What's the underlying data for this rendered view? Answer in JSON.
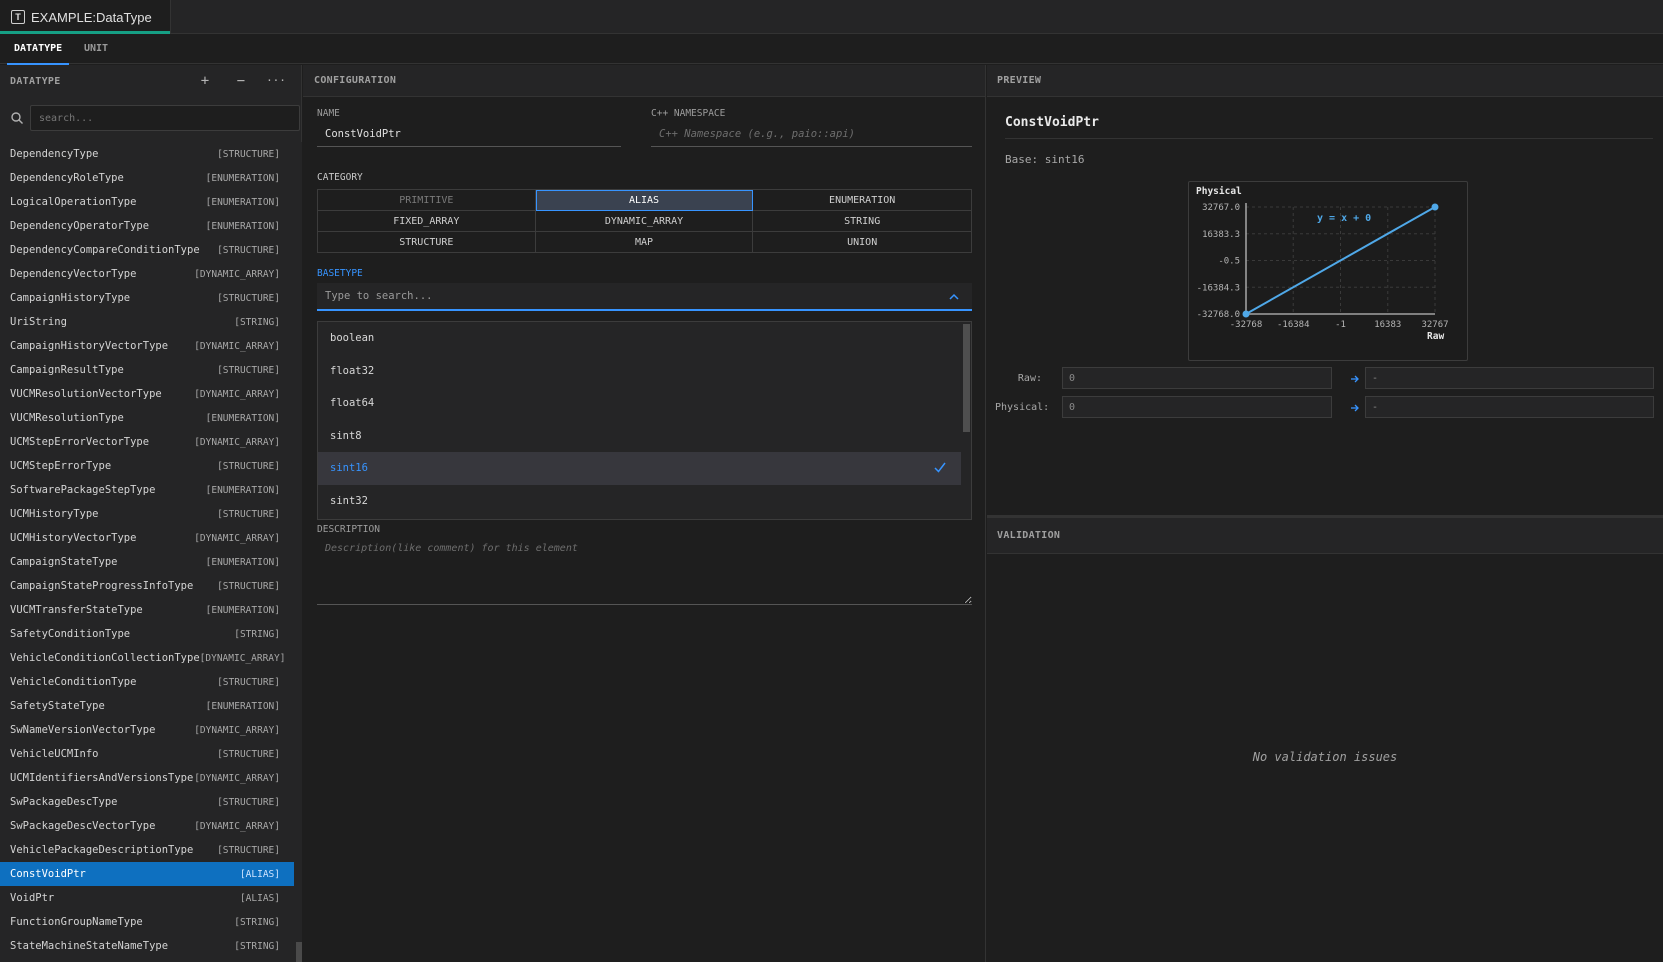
{
  "window": {
    "tab_title": "EXAMPLE:DataType",
    "tab_icon": "T"
  },
  "subtabs": [
    {
      "label": "DATATYPE",
      "active": true
    },
    {
      "label": "UNIT",
      "active": false
    }
  ],
  "left_panel": {
    "title": "DATATYPE",
    "add_label": "+",
    "remove_label": "−",
    "more_label": "···",
    "search_placeholder": "search...",
    "items": [
      {
        "name": "DependencyType",
        "kind": "[STRUCTURE]"
      },
      {
        "name": "DependencyRoleType",
        "kind": "[ENUMERATION]"
      },
      {
        "name": "LogicalOperationType",
        "kind": "[ENUMERATION]"
      },
      {
        "name": "DependencyOperatorType",
        "kind": "[ENUMERATION]"
      },
      {
        "name": "DependencyCompareConditionType",
        "kind": "[STRUCTURE]"
      },
      {
        "name": "DependencyVectorType",
        "kind": "[DYNAMIC_ARRAY]"
      },
      {
        "name": "CampaignHistoryType",
        "kind": "[STRUCTURE]"
      },
      {
        "name": "UriString",
        "kind": "[STRING]"
      },
      {
        "name": "CampaignHistoryVectorType",
        "kind": "[DYNAMIC_ARRAY]"
      },
      {
        "name": "CampaignResultType",
        "kind": "[STRUCTURE]"
      },
      {
        "name": "VUCMResolutionVectorType",
        "kind": "[DYNAMIC_ARRAY]"
      },
      {
        "name": "VUCMResolutionType",
        "kind": "[ENUMERATION]"
      },
      {
        "name": "UCMStepErrorVectorType",
        "kind": "[DYNAMIC_ARRAY]"
      },
      {
        "name": "UCMStepErrorType",
        "kind": "[STRUCTURE]"
      },
      {
        "name": "SoftwarePackageStepType",
        "kind": "[ENUMERATION]"
      },
      {
        "name": "UCMHistoryType",
        "kind": "[STRUCTURE]"
      },
      {
        "name": "UCMHistoryVectorType",
        "kind": "[DYNAMIC_ARRAY]"
      },
      {
        "name": "CampaignStateType",
        "kind": "[ENUMERATION]"
      },
      {
        "name": "CampaignStateProgressInfoType",
        "kind": "[STRUCTURE]"
      },
      {
        "name": "VUCMTransferStateType",
        "kind": "[ENUMERATION]"
      },
      {
        "name": "SafetyConditionType",
        "kind": "[STRING]"
      },
      {
        "name": "VehicleConditionCollectionType",
        "kind": "[DYNAMIC_ARRAY]"
      },
      {
        "name": "VehicleConditionType",
        "kind": "[STRUCTURE]"
      },
      {
        "name": "SafetyStateType",
        "kind": "[ENUMERATION]"
      },
      {
        "name": "SwNameVersionVectorType",
        "kind": "[DYNAMIC_ARRAY]"
      },
      {
        "name": "VehicleUCMInfo",
        "kind": "[STRUCTURE]"
      },
      {
        "name": "UCMIdentifiersAndVersionsType",
        "kind": "[DYNAMIC_ARRAY]"
      },
      {
        "name": "SwPackageDescType",
        "kind": "[STRUCTURE]"
      },
      {
        "name": "SwPackageDescVectorType",
        "kind": "[DYNAMIC_ARRAY]"
      },
      {
        "name": "VehiclePackageDescriptionType",
        "kind": "[STRUCTURE]"
      },
      {
        "name": "ConstVoidPtr",
        "kind": "[ALIAS]",
        "selected": true
      },
      {
        "name": "VoidPtr",
        "kind": "[ALIAS]"
      },
      {
        "name": "FunctionGroupNameType",
        "kind": "[STRING]"
      },
      {
        "name": "StateMachineStateNameType",
        "kind": "[STRING]"
      }
    ]
  },
  "config": {
    "title": "CONFIGURATION",
    "name_label": "NAME",
    "name_value": "ConstVoidPtr",
    "namespace_label": "C++ NAMESPACE",
    "namespace_placeholder": "C++ Namespace (e.g., paio::api)",
    "category_label": "CATEGORY",
    "categories": [
      {
        "label": "PRIMITIVE",
        "state": "disabled"
      },
      {
        "label": "ALIAS",
        "state": "active"
      },
      {
        "label": "ENUMERATION",
        "state": "normal"
      },
      {
        "label": "FIXED_ARRAY",
        "state": "normal"
      },
      {
        "label": "DYNAMIC_ARRAY",
        "state": "normal"
      },
      {
        "label": "STRING",
        "state": "normal"
      },
      {
        "label": "STRUCTURE",
        "state": "normal"
      },
      {
        "label": "MAP",
        "state": "normal"
      },
      {
        "label": "UNION",
        "state": "normal"
      }
    ],
    "basetype_label": "BASETYPE",
    "basetype_placeholder": "Type to search...",
    "basetype_options": [
      {
        "label": "boolean"
      },
      {
        "label": "float32"
      },
      {
        "label": "float64"
      },
      {
        "label": "sint8"
      },
      {
        "label": "sint16",
        "selected": true
      },
      {
        "label": "sint32"
      }
    ],
    "description_label": "DESCRIPTION",
    "description_placeholder": "Description(like comment) for this element"
  },
  "preview": {
    "title": "PREVIEW",
    "name": "ConstVoidPtr",
    "base": "Base: sint16",
    "raw_label": "Raw:",
    "raw_value": "0",
    "raw_result": "-",
    "physical_label": "Physical:",
    "physical_value": "0",
    "physical_result": "-"
  },
  "chart_data": {
    "type": "line",
    "ylabel": "Physical",
    "xlabel": "Raw",
    "formula": "y = x + 0",
    "x_ticks": [
      "-32768",
      "-16384",
      "-1",
      "16383",
      "32767"
    ],
    "y_ticks": [
      "32767.0",
      "16383.3",
      "-0.5",
      "-16384.3",
      "-32768.0"
    ],
    "xlim": [
      -32768,
      32767
    ],
    "ylim": [
      -32768,
      32767
    ],
    "series": [
      {
        "x": [
          -32768,
          32767
        ],
        "y": [
          -32768,
          32767
        ]
      }
    ],
    "line_color": "#4fa8e8",
    "grid": true
  },
  "validation": {
    "title": "VALIDATION",
    "empty_message": "No validation issues"
  }
}
